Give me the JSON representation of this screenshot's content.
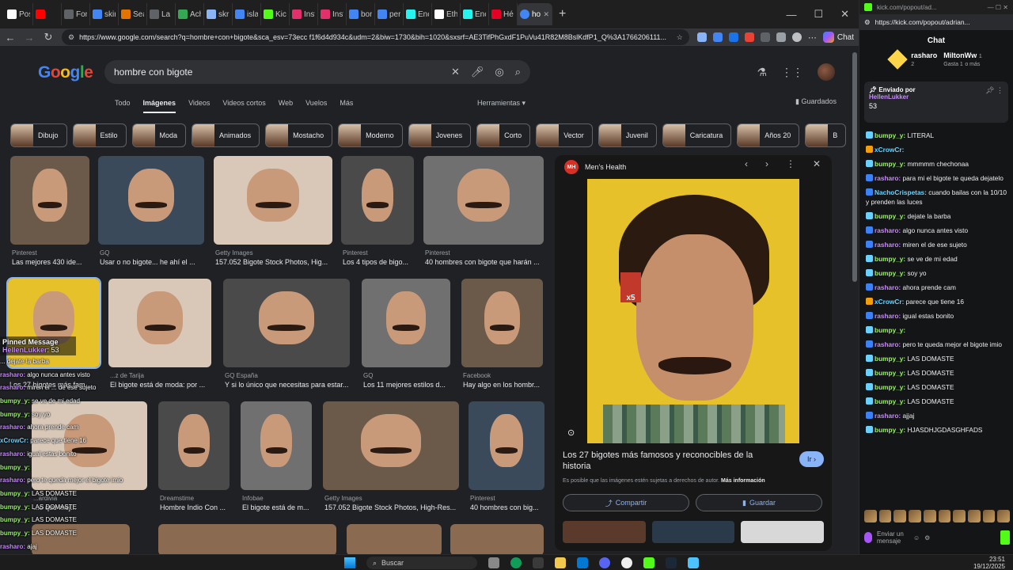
{
  "browser": {
    "tabs": [
      {
        "label": "Pos",
        "color": "#ffffff"
      },
      {
        "label": "",
        "color": "#ff0000"
      },
      {
        "label": "Fon",
        "color": "#5f6368"
      },
      {
        "label": "skin",
        "color": "#4285f4"
      },
      {
        "label": "Sea",
        "color": "#e37400"
      },
      {
        "label": "La F",
        "color": "#5f6368"
      },
      {
        "label": "Ach",
        "color": "#34a853"
      },
      {
        "label": "skri",
        "color": "#8ab4f8"
      },
      {
        "label": "isla",
        "color": "#4285f4"
      },
      {
        "label": "Kick",
        "color": "#53fc18"
      },
      {
        "label": "Inst",
        "color": "#e1306c"
      },
      {
        "label": "Inst",
        "color": "#e1306c"
      },
      {
        "label": "bon",
        "color": "#4285f4"
      },
      {
        "label": "per",
        "color": "#4285f4"
      },
      {
        "label": "Enc",
        "color": "#25f4ee"
      },
      {
        "label": "Eth",
        "color": "#ffffff"
      },
      {
        "label": "Enc",
        "color": "#25f4ee"
      },
      {
        "label": "Hé",
        "color": "#e60023"
      }
    ],
    "active_tab": {
      "label": "hon",
      "color": "#4285f4"
    },
    "url": "https://www.google.com/search?q=hombre+con+bigote&sca_esv=73ecc f1f6d4d934c&udm=2&biw=1730&bih=1020&sxsrf=AE3TifPhGxdF1PuVu41R82M8BslKdfP1_Q%3A1766206111...",
    "chat_button": "Chat"
  },
  "google": {
    "logo": [
      "G",
      "o",
      "o",
      "g",
      "l",
      "e"
    ],
    "query": "hombre con bigote",
    "tabs": [
      "Todo",
      "Imágenes",
      "Videos",
      "Videos cortos",
      "Web",
      "Vuelos",
      "Más"
    ],
    "active_tab": "Imágenes",
    "tools": "Herramientas",
    "saved": "Guardados",
    "chips": [
      "Dibujo",
      "Estilo",
      "Moda",
      "Animados",
      "Mostacho",
      "Moderno",
      "Jovenes",
      "Corto",
      "Vector",
      "Juvenil",
      "Caricatura",
      "Años 20",
      "B"
    ],
    "results_row1": [
      {
        "source": "Pinterest",
        "title": "Las mejores 430 ide..."
      },
      {
        "source": "GQ",
        "title": "Usar o no bigote... he ahí el ..."
      },
      {
        "source": "Getty Images",
        "title": "157.052 Bigote Stock Photos, Hig..."
      },
      {
        "source": "Pinterest",
        "title": "Los 4 tipos de bigo..."
      },
      {
        "source": "Pinterest",
        "title": "40 hombres con bigote que harán ..."
      }
    ],
    "results_row2": [
      {
        "source": "",
        "title": "Los 27 bigotes más fam..."
      },
      {
        "source": "...z de Tarija",
        "title": "El bigote está de moda: por ..."
      },
      {
        "source": "GQ España",
        "title": "Y si lo único que necesitas para estar..."
      },
      {
        "source": "GQ",
        "title": "Los 11 mejores estilos d..."
      },
      {
        "source": "Facebook",
        "title": "Hay algo en los hombr..."
      }
    ],
    "results_row3": [
      {
        "source": "...ardivia",
        "title": "...o que mej..."
      },
      {
        "source": "Dreamstime",
        "title": "Hombre Indio Con ..."
      },
      {
        "source": "Infobae",
        "title": "El bigote está de m..."
      },
      {
        "source": "Getty Images",
        "title": "157.052 Bigote Stock Photos, High-Res..."
      },
      {
        "source": "Pinterest",
        "title": "40 hombres con big..."
      }
    ]
  },
  "preview": {
    "source": "Men's Health",
    "logo_text": "MH",
    "title": "Los 27 bigotes más famosos y reconocibles de la historia",
    "go_button": "Ir",
    "rights_text": "Es posible que las imágenes estén sujetas a derechos de autor.",
    "rights_link": "Más información",
    "share": "Compartir",
    "save": "Guardar",
    "badge": "x5"
  },
  "overlay": {
    "pinned_title": "Pinned Message",
    "pinned_user": "HellenLukker",
    "pinned_value": "53",
    "lines": [
      {
        "user": "",
        "text": "... dejate la barba",
        "cls": "u1"
      },
      {
        "user": "rasharo:",
        "text": "algo nunca antes visto",
        "cls": "u2"
      },
      {
        "user": "rasharo:",
        "text": "miren el ... de ese sujeto",
        "cls": "u2"
      },
      {
        "user": "bumpy_y:",
        "text": "se ve de mi edad",
        "cls": "u1"
      },
      {
        "user": "bumpy_y:",
        "text": "soy yo",
        "cls": "u1"
      },
      {
        "user": "rasharo:",
        "text": "ahora prende cam",
        "cls": "u2"
      },
      {
        "user": "xCrowCr:",
        "text": "parece que tiene 16",
        "cls": "u3"
      },
      {
        "user": "rasharo:",
        "text": "igual estas bonito",
        "cls": "u2"
      },
      {
        "user": "bumpy_y:",
        "text": "",
        "cls": "u1"
      },
      {
        "user": "rasharo:",
        "text": "pero te queda mejor el bigote imio",
        "cls": "u2"
      },
      {
        "user": "bumpy_y:",
        "text": "LAS DOMASTE",
        "cls": "u1"
      },
      {
        "user": "bumpy_y:",
        "text": "LAS DOMASTE",
        "cls": "u1"
      },
      {
        "user": "bumpy_y:",
        "text": "LAS DOMASTE",
        "cls": "u1"
      },
      {
        "user": "bumpy_y:",
        "text": "LAS DOMASTE",
        "cls": "u1"
      },
      {
        "user": "rasharo:",
        "text": "ajaj",
        "cls": "u2"
      },
      {
        "user": "bumpy_y:",
        "text": "HJASDHJGDASGHFADS",
        "cls": "u1"
      }
    ]
  },
  "kick": {
    "tab_title": "kick.com/popout/ad...",
    "url": "https://kick.com/popout/adrian...",
    "heading": "Chat",
    "top1": {
      "name": "rasharo",
      "count": "2"
    },
    "top2": {
      "name": "MiltonWw",
      "count": "1",
      "sub": "Gasta 1",
      "sub2": "o más"
    },
    "pinned_by": "Enviado por",
    "pinned_user": "HellenLukker",
    "pinned_value": "53",
    "messages": [
      {
        "user": "bumpy_y:",
        "text": "LITERAL",
        "cls": "ub",
        "badge": "#6ad1ff"
      },
      {
        "user": "xCrowCr:",
        "text": "",
        "cls": "ux",
        "badge": "#f59e0b"
      },
      {
        "user": "bumpy_y:",
        "text": "mmmmm chechonaa",
        "cls": "ub",
        "badge": "#6ad1ff"
      },
      {
        "user": "rasharo:",
        "text": "para mi el bigote te queda dejatelo",
        "cls": "ur",
        "badge": "#3b82f6"
      },
      {
        "user": "NachoCrispetas:",
        "text": "cuando bailas con la 10/10 y prenden las luces",
        "cls": "un",
        "badge": "#3b82f6"
      },
      {
        "user": "bumpy_y:",
        "text": "dejate la barba",
        "cls": "ub",
        "badge": "#6ad1ff"
      },
      {
        "user": "rasharo:",
        "text": "algo nunca antes visto",
        "cls": "ur",
        "badge": "#3b82f6"
      },
      {
        "user": "rasharo:",
        "text": "miren el  de ese sujeto",
        "cls": "ur",
        "badge": "#3b82f6"
      },
      {
        "user": "bumpy_y:",
        "text": "se ve de mi edad",
        "cls": "ub",
        "badge": "#6ad1ff"
      },
      {
        "user": "bumpy_y:",
        "text": "soy yo",
        "cls": "ub",
        "badge": "#6ad1ff"
      },
      {
        "user": "rasharo:",
        "text": "ahora prende cam",
        "cls": "ur",
        "badge": "#3b82f6"
      },
      {
        "user": "xCrowCr:",
        "text": "parece que tiene 16",
        "cls": "ux",
        "badge": "#f59e0b"
      },
      {
        "user": "rasharo:",
        "text": "igual estas bonito",
        "cls": "ur",
        "badge": "#3b82f6"
      },
      {
        "user": "bumpy_y:",
        "text": "",
        "cls": "ub",
        "badge": "#6ad1ff"
      },
      {
        "user": "rasharo:",
        "text": "pero te queda mejor el bigote imio",
        "cls": "ur",
        "badge": "#3b82f6"
      },
      {
        "user": "bumpy_y:",
        "text": "LAS DOMASTE",
        "cls": "ub",
        "badge": "#6ad1ff"
      },
      {
        "user": "bumpy_y:",
        "text": "LAS DOMASTE",
        "cls": "ub",
        "badge": "#6ad1ff"
      },
      {
        "user": "bumpy_y:",
        "text": "LAS DOMASTE",
        "cls": "ub",
        "badge": "#6ad1ff"
      },
      {
        "user": "bumpy_y:",
        "text": "LAS DOMASTE",
        "cls": "ub",
        "badge": "#6ad1ff"
      },
      {
        "user": "rasharo:",
        "text": "ajjaj",
        "cls": "ur",
        "badge": "#3b82f6"
      },
      {
        "user": "bumpy_y:",
        "text": "HJASDHJGDASGHFADS",
        "cls": "ub",
        "badge": "#6ad1ff"
      }
    ],
    "input_placeholder": "Enviar un mensaje"
  },
  "taskbar": {
    "search": "Buscar",
    "time": "23:51",
    "date": "19/12/2025"
  }
}
